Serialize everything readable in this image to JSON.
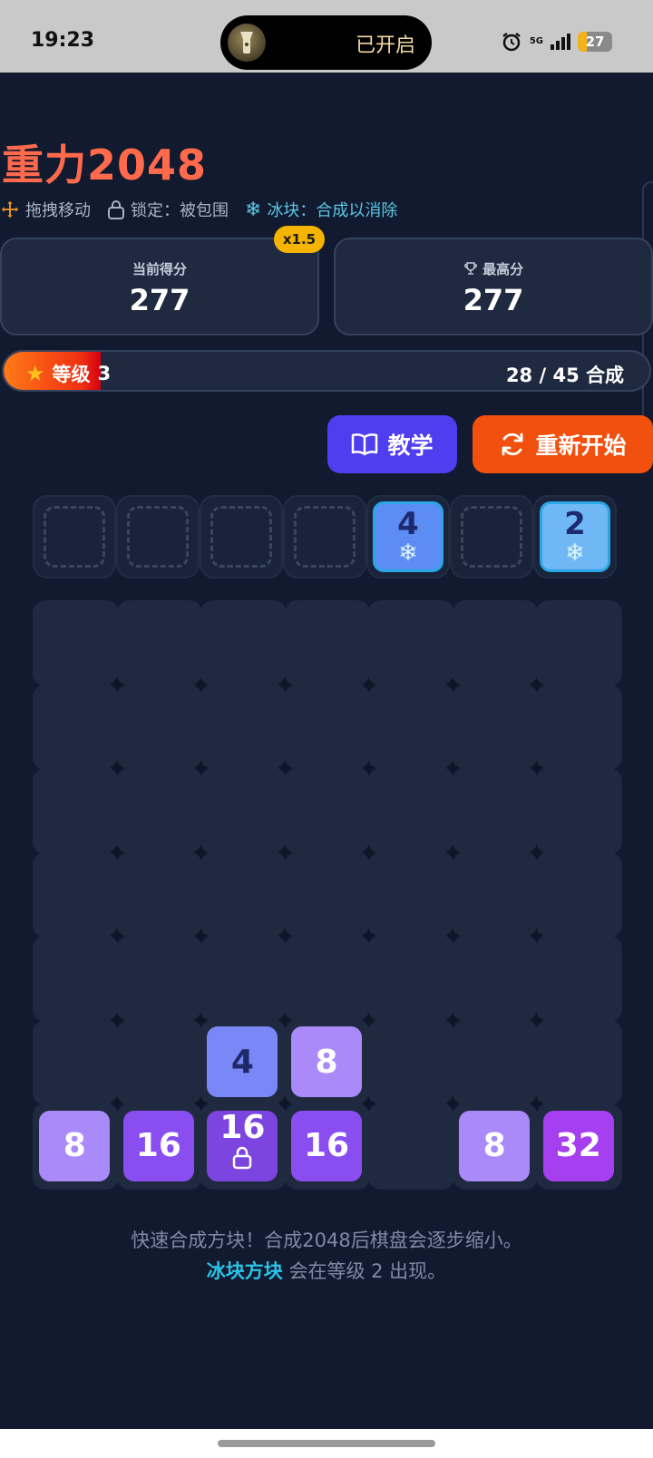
{
  "status_bar": {
    "time": "19:23",
    "island_label": "已开启",
    "network": "5G",
    "battery": "27"
  },
  "header": {
    "title": "重力2048",
    "legend": [
      {
        "icon": "move-arrows-icon",
        "label": "拖拽移动"
      },
      {
        "icon": "lock-icon",
        "label": "锁定：被包围"
      },
      {
        "icon": "snowflake-icon",
        "label": "冰块：合成以消除"
      }
    ]
  },
  "scores": {
    "current_label": "当前得分",
    "current_value": "277",
    "multiplier": "x1.5",
    "best_label": "最高分",
    "best_value": "277"
  },
  "level": {
    "label": "等级",
    "value": "3",
    "progress_text": "28 / 45 合成",
    "progress_fraction": 0.15
  },
  "buttons": {
    "tutorial": "教学",
    "restart": "重新开始"
  },
  "preview": [
    {
      "value": "",
      "ice": false
    },
    {
      "value": "",
      "ice": false
    },
    {
      "value": "",
      "ice": false
    },
    {
      "value": "",
      "ice": false
    },
    {
      "value": "4",
      "ice": true,
      "color": "#5b8df5"
    },
    {
      "value": "",
      "ice": false
    },
    {
      "value": "2",
      "ice": true,
      "color": "#6fb8f5"
    }
  ],
  "board": {
    "size": 7,
    "tiles": [
      {
        "row": 5,
        "col": 2,
        "value": "4",
        "color": "#7a88f7",
        "text_color": "#1f2a6b",
        "locked": false
      },
      {
        "row": 5,
        "col": 3,
        "value": "8",
        "color": "#a98af8",
        "text_color": "#ffffff",
        "locked": false
      },
      {
        "row": 6,
        "col": 0,
        "value": "8",
        "color": "#a98af8",
        "text_color": "#ffffff",
        "locked": false
      },
      {
        "row": 6,
        "col": 1,
        "value": "16",
        "color": "#8a4df0",
        "text_color": "#ffffff",
        "locked": false
      },
      {
        "row": 6,
        "col": 2,
        "value": "16",
        "color": "#7c45e0",
        "text_color": "#ffffff",
        "locked": true
      },
      {
        "row": 6,
        "col": 3,
        "value": "16",
        "color": "#8a4df0",
        "text_color": "#ffffff",
        "locked": false
      },
      {
        "row": 6,
        "col": 5,
        "value": "8",
        "color": "#a98af8",
        "text_color": "#ffffff",
        "locked": false
      },
      {
        "row": 6,
        "col": 6,
        "value": "32",
        "color": "#a63ff0",
        "text_color": "#ffffff",
        "locked": false
      }
    ]
  },
  "help": {
    "line1": "快速合成方块！合成2048后棋盘会逐步缩小。",
    "line2_highlight": "冰块方块",
    "line2_rest": " 会在等级 2 出现。"
  }
}
